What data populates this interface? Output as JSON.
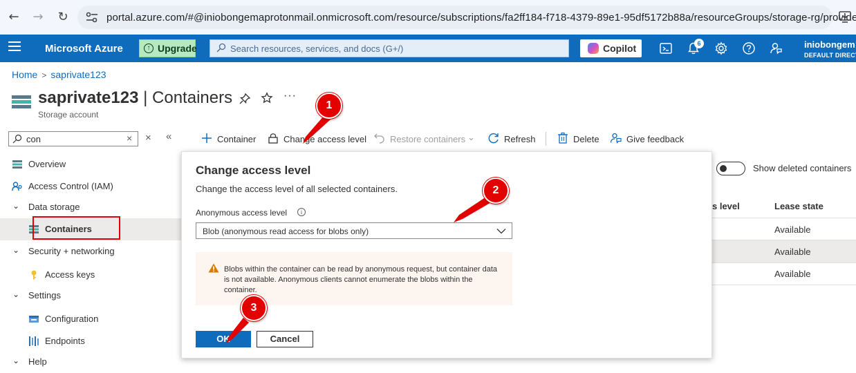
{
  "browser": {
    "url": "portal.azure.com/#@iniobongemaprotonmail.onmicrosoft.com/resource/subscriptions/fa2ff184-f718-4379-89e1-95df5172b88a/resourceGroups/storage-rg/providers/..."
  },
  "topbar": {
    "brand": "Microsoft Azure",
    "upgrade_label": "Upgrade",
    "search_placeholder": "Search resources, services, and docs (G+/)",
    "copilot_label": "Copilot",
    "notification_count": "6",
    "user_name": "iniobongem",
    "user_directory": "DEFAULT DIRECT"
  },
  "breadcrumb": {
    "home": "Home",
    "current": "saprivate123"
  },
  "header": {
    "resource_name": "saprivate123",
    "page_name": "| Containers",
    "subtitle": "Storage account"
  },
  "sidebar": {
    "filter_value": "con",
    "items": [
      {
        "label": "Overview"
      },
      {
        "label": "Access Control (IAM)"
      },
      {
        "label": "Data storage"
      },
      {
        "label": "Containers"
      },
      {
        "label": "Security + networking"
      },
      {
        "label": "Access keys"
      },
      {
        "label": "Settings"
      },
      {
        "label": "Configuration"
      },
      {
        "label": "Endpoints"
      },
      {
        "label": "Help"
      }
    ]
  },
  "toolbar": {
    "container": "Container",
    "change_access": "Change access level",
    "restore": "Restore containers",
    "refresh": "Refresh",
    "delete": "Delete",
    "feedback": "Give feedback"
  },
  "table": {
    "show_deleted_label": "Show deleted containers",
    "col_access_partial": "s level",
    "col_lease": "Lease state",
    "lease_values": [
      "Available",
      "Available",
      "Available"
    ]
  },
  "dialog": {
    "title": "Change access level",
    "description": "Change the access level of all selected containers.",
    "field_label": "Anonymous access level",
    "selected_value": "Blob (anonymous read access for blobs only)",
    "warning": "Blobs within the container can be read by anonymous request, but container data is not available. Anonymous clients cannot enumerate the blobs within the container.",
    "ok_label": "OK",
    "cancel_label": "Cancel"
  },
  "annotations": {
    "step1": "1",
    "step2": "2",
    "step3": "3",
    "color": "#e30000"
  },
  "colors": {
    "azure_blue": "#0f6cbd",
    "upgrade_green": "#b7e8c4",
    "warning_bg": "#fdf6f0",
    "warning_icon": "#d87b00"
  }
}
